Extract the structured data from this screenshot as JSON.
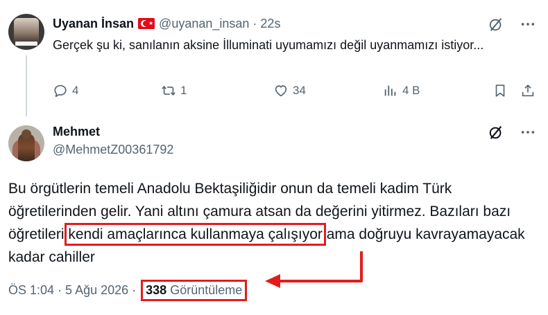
{
  "tweet1": {
    "name": "Uyanan İnsan",
    "handle": "@uyanan_insan",
    "separator": "·",
    "time": "22s",
    "text": "Gerçek şu ki, sanılanın aksine İlluminati uyumamızı değil uyanmamızı istiyor...",
    "replies": "4",
    "reposts": "1",
    "likes": "34",
    "views": "4 B"
  },
  "tweet2": {
    "name": "Mehmet",
    "handle": "@MehmetZ00361792",
    "text_before": "Bu örgütlerin temeli Anadolu Bektaşiliğidir onun da temeli kadim Türk öğretilerinden gelir. Yani altını çamura atsan da değerini yitirmez. Bazıları bazı öğretileri ",
    "text_highlight": "kendi amaçlarınca kullanmaya çalışıyor",
    "text_after": " ama doğruyu kavrayamayacak kadar cahiller",
    "time": "ÖS 1:04",
    "separator": "·",
    "date": "5 Ağu 2026",
    "separator2": "·",
    "view_count": "338",
    "view_label": "Görüntüleme"
  },
  "annotation": {
    "color": "#e51b1b"
  }
}
